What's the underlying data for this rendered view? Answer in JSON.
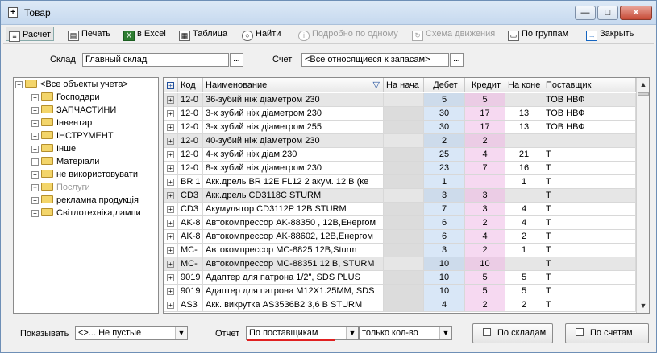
{
  "window": {
    "title": "Товар",
    "title_icon": "document-plus-icon",
    "buttons": {
      "minimize": "—",
      "maximize": "□",
      "close": "✕"
    }
  },
  "toolbar": {
    "items": [
      {
        "label": "Расчет",
        "icon": "calc-icon",
        "state": "pressed"
      },
      {
        "label": "Печать",
        "icon": "printer-icon"
      },
      {
        "label": "в Excel",
        "icon": "excel-icon"
      },
      {
        "label": "Таблица",
        "icon": "table-icon"
      },
      {
        "label": "Найти",
        "icon": "search-icon"
      },
      {
        "label": "Подробно по одному",
        "icon": "info-icon",
        "state": "disabled"
      },
      {
        "label": "Схема движения",
        "icon": "refresh-icon",
        "state": "disabled"
      },
      {
        "label": "По группам",
        "icon": "groups-icon"
      },
      {
        "label": "Закрыть",
        "icon": "exit-icon"
      }
    ]
  },
  "filters": {
    "warehouse_label": "Склад",
    "warehouse_value": "Главный склад",
    "account_label": "Счет",
    "account_value": "<Все относящиеся к запасам>",
    "dots": "..."
  },
  "tree": {
    "root": "<Все объекты учета>",
    "items": [
      {
        "label": "Господари",
        "grey": false
      },
      {
        "label": "ЗАПЧАСТИНИ",
        "grey": false
      },
      {
        "label": "Інвентар",
        "grey": false
      },
      {
        "label": "ІНСТРУМЕНТ",
        "grey": false
      },
      {
        "label": "Інше",
        "grey": false
      },
      {
        "label": "Матеріали",
        "grey": false
      },
      {
        "label": "не використовувати",
        "grey": false
      },
      {
        "label": "Послуги",
        "grey": true
      },
      {
        "label": "рекламна продукція",
        "grey": false
      },
      {
        "label": "Світлотехніка,лампи",
        "grey": false
      }
    ]
  },
  "grid": {
    "columns": [
      "Код",
      "Наименование",
      "На нача",
      "Дебет",
      "Кредит",
      "На коне",
      "Поставщик"
    ],
    "rows": [
      {
        "code": "12-0",
        "name": "36-зубий ніж діаметром 230",
        "nach": "",
        "debet": "5",
        "kredit": "5",
        "kon": "",
        "post": "ТОВ НВФ",
        "sel": true
      },
      {
        "code": "12-0",
        "name": "3-х зубий ніж діаметром 230",
        "nach": "",
        "debet": "30",
        "kredit": "17",
        "kon": "13",
        "post": "ТОВ НВФ",
        "sel": false
      },
      {
        "code": "12-0",
        "name": "3-х зубий ніж діаметром 255",
        "nach": "",
        "debet": "30",
        "kredit": "17",
        "kon": "13",
        "post": "ТОВ НВФ",
        "sel": false
      },
      {
        "code": "12-0",
        "name": "40-зубий ніж діаметром 230",
        "nach": "",
        "debet": "2",
        "kredit": "2",
        "kon": "",
        "post": "",
        "sel": true
      },
      {
        "code": "12-0",
        "name": "4-х зубий ніж діам.230",
        "nach": "",
        "debet": "25",
        "kredit": "4",
        "kon": "21",
        "post": "Т",
        "sel": false
      },
      {
        "code": "12-0",
        "name": "8-х зубий ніж діаметром 230",
        "nach": "",
        "debet": "23",
        "kredit": "7",
        "kon": "16",
        "post": "Т",
        "sel": false
      },
      {
        "code": "BR 1",
        "name": "Акк.дрель BR 12E FL12  2 акум. 12 В  (ке",
        "nach": "",
        "debet": "1",
        "kredit": "",
        "kon": "1",
        "post": "Т",
        "sel": false
      },
      {
        "code": "CD3",
        "name": "Акк.дрель CD3118C STURM",
        "nach": "",
        "debet": "3",
        "kredit": "3",
        "kon": "",
        "post": "Т",
        "sel": true
      },
      {
        "code": "CD3",
        "name": "Акумулятор CD3112P 12В STURM",
        "nach": "",
        "debet": "7",
        "kredit": "3",
        "kon": "4",
        "post": "Т",
        "sel": false
      },
      {
        "code": "AK-8",
        "name": "Автокомпрессор AK-88350 , 12В,Енергом",
        "nach": "",
        "debet": "6",
        "kredit": "2",
        "kon": "4",
        "post": "Т",
        "sel": false
      },
      {
        "code": "AK-8",
        "name": "Автокомпрессор AK-88602, 12В,Енергом",
        "nach": "",
        "debet": "6",
        "kredit": "4",
        "kon": "2",
        "post": "Т",
        "sel": false
      },
      {
        "code": "MC-",
        "name": "Автокомпрессор МС-8825 12В,Sturm",
        "nach": "",
        "debet": "3",
        "kredit": "2",
        "kon": "1",
        "post": "Т",
        "sel": false
      },
      {
        "code": "MC-",
        "name": "Автокомпрессор МС-88351 12 В, STURM",
        "nach": "",
        "debet": "10",
        "kredit": "10",
        "kon": "",
        "post": "Т",
        "sel": true
      },
      {
        "code": "9019",
        "name": "Адаптер для патрона 1/2\", SDS PLUS",
        "nach": "",
        "debet": "10",
        "kredit": "5",
        "kon": "5",
        "post": "Т",
        "sel": false
      },
      {
        "code": "9019",
        "name": "Адаптер для патрона M12X1.25MM, SDS",
        "nach": "",
        "debet": "10",
        "kredit": "5",
        "kon": "5",
        "post": "Т",
        "sel": false
      },
      {
        "code": "AS3",
        "name": "Акк. викрутка  AS3536B2 3,6 В STURM",
        "nach": "",
        "debet": "4",
        "kredit": "2",
        "kon": "2",
        "post": "Т",
        "sel": false
      }
    ]
  },
  "bottom": {
    "show_label": "Показывать",
    "show_value": "<>...    Не пустые",
    "report_label": "Отчет",
    "report_value": "По поставщикам",
    "qty_value": "только кол-во",
    "by_warehouses": "По складам",
    "by_accounts": "По счетам"
  },
  "colors": {
    "debet_bg": "#d9e7f7",
    "kredit_bg": "#f6d9f1",
    "accent_underline": "#e02020"
  }
}
